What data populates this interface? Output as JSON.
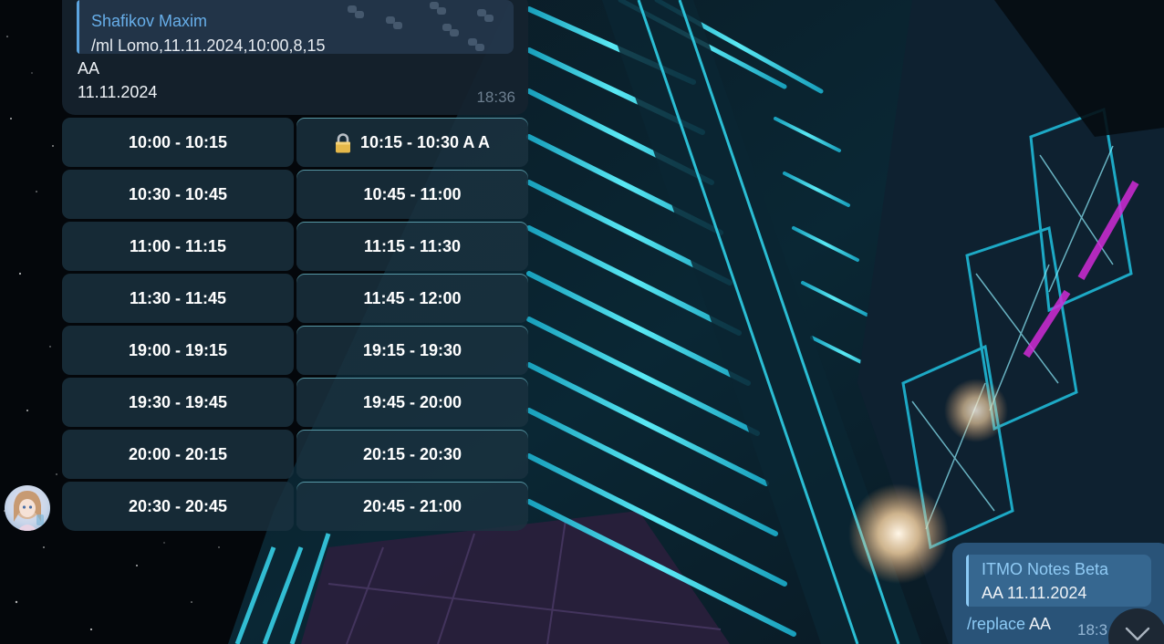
{
  "colors": {
    "accent": "#67aee9",
    "incoming_bubble": "#16222e",
    "outgoing_bubble": "#2c567c",
    "keyboard_button": "#1b3240",
    "neon": "#2fe3ff"
  },
  "incoming_message": {
    "reply": {
      "author": "Shafikov Maxim",
      "text": "/ml Lomo,11.11.2024,10:00,8,15"
    },
    "lines": [
      "AA",
      "11.11.2024"
    ],
    "time": "18:36"
  },
  "keyboard": {
    "buttons": [
      {
        "label": "10:00 - 10:15",
        "locked": false
      },
      {
        "label": "10:15 - 10:30 A A",
        "locked": true,
        "icon": "lock-icon"
      },
      {
        "label": "10:30 - 10:45",
        "locked": false
      },
      {
        "label": "10:45 - 11:00",
        "locked": false
      },
      {
        "label": "11:00 - 11:15",
        "locked": false
      },
      {
        "label": "11:15 - 11:30",
        "locked": false
      },
      {
        "label": "11:30 - 11:45",
        "locked": false
      },
      {
        "label": "11:45 - 12:00",
        "locked": false
      },
      {
        "label": "19:00 - 19:15",
        "locked": false
      },
      {
        "label": "19:15 - 19:30",
        "locked": false
      },
      {
        "label": "19:30 - 19:45",
        "locked": false
      },
      {
        "label": "19:45 - 20:00",
        "locked": false
      },
      {
        "label": "20:00 - 20:15",
        "locked": false
      },
      {
        "label": "20:15 - 20:30",
        "locked": false
      },
      {
        "label": "20:30 - 20:45",
        "locked": false
      },
      {
        "label": "20:45 - 21:00",
        "locked": false
      }
    ]
  },
  "outgoing_message": {
    "reply": {
      "author": "ITMO Notes Beta",
      "text": "AA 11.11.2024"
    },
    "command": "/replace",
    "argument": " AA",
    "time": "18:3"
  },
  "icons": {
    "avatar": "avatar",
    "scroll_down": "chevron-down-icon",
    "lock": "lock-icon"
  }
}
